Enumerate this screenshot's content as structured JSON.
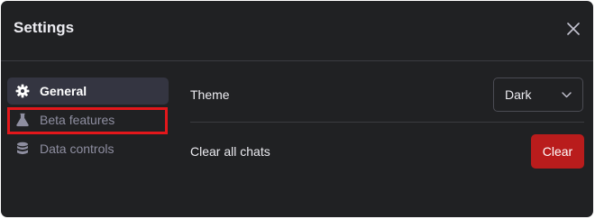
{
  "dialog": {
    "title": "Settings",
    "close_icon": "close-icon"
  },
  "sidebar": {
    "items": [
      {
        "label": "General",
        "icon": "gear-icon",
        "active": true
      },
      {
        "label": "Beta features",
        "icon": "flask-icon",
        "active": false,
        "highlighted": true
      },
      {
        "label": "Data controls",
        "icon": "database-icon",
        "active": false
      }
    ]
  },
  "general": {
    "theme_label": "Theme",
    "theme_value": "Dark",
    "clear_chats_label": "Clear all chats",
    "clear_button_label": "Clear"
  },
  "colors": {
    "background": "#202123",
    "active_item": "#343541",
    "danger": "#b91c1c",
    "highlight_box": "#e3171b"
  }
}
